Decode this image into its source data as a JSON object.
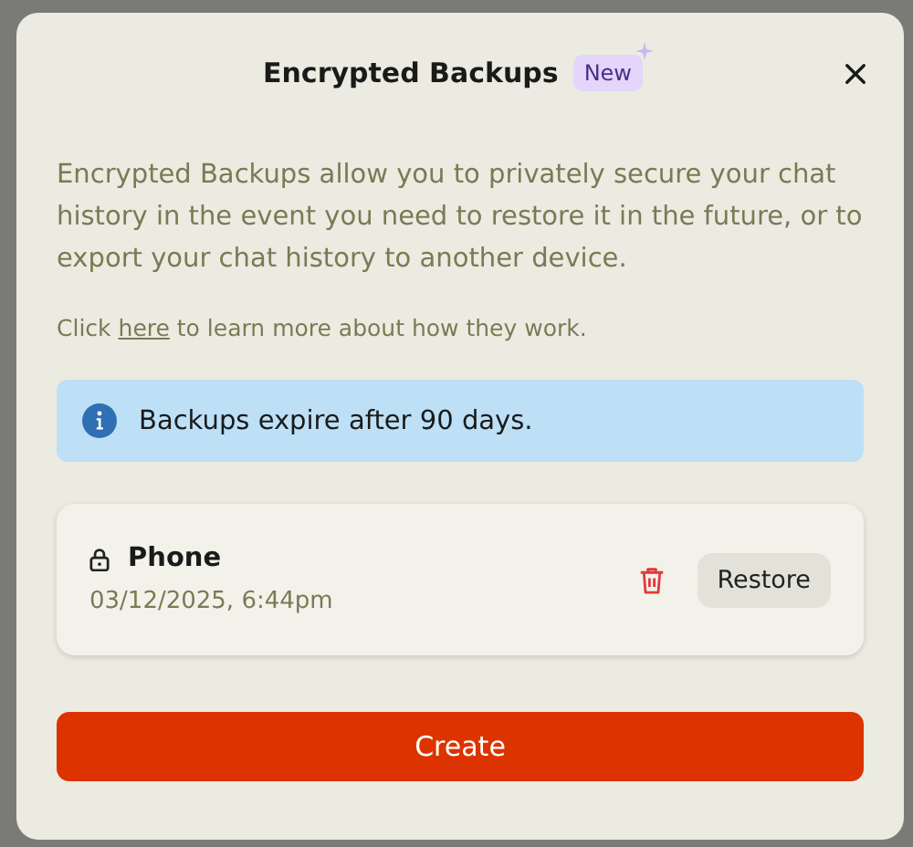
{
  "dialog": {
    "title": "Encrypted Backups",
    "badge": "New",
    "description": "Encrypted Backups allow you to privately secure your chat history in the event you need to restore it in the future, or to export your chat history to another device.",
    "more_info": {
      "before": "Click ",
      "link": "here",
      "after": " to learn more about how they work."
    },
    "notice": "Backups expire after 90 days.",
    "backups": [
      {
        "name": "Phone",
        "date": "03/12/2025, 6:44pm",
        "locked": true,
        "action": "Restore"
      }
    ],
    "primary_button": "Create"
  }
}
